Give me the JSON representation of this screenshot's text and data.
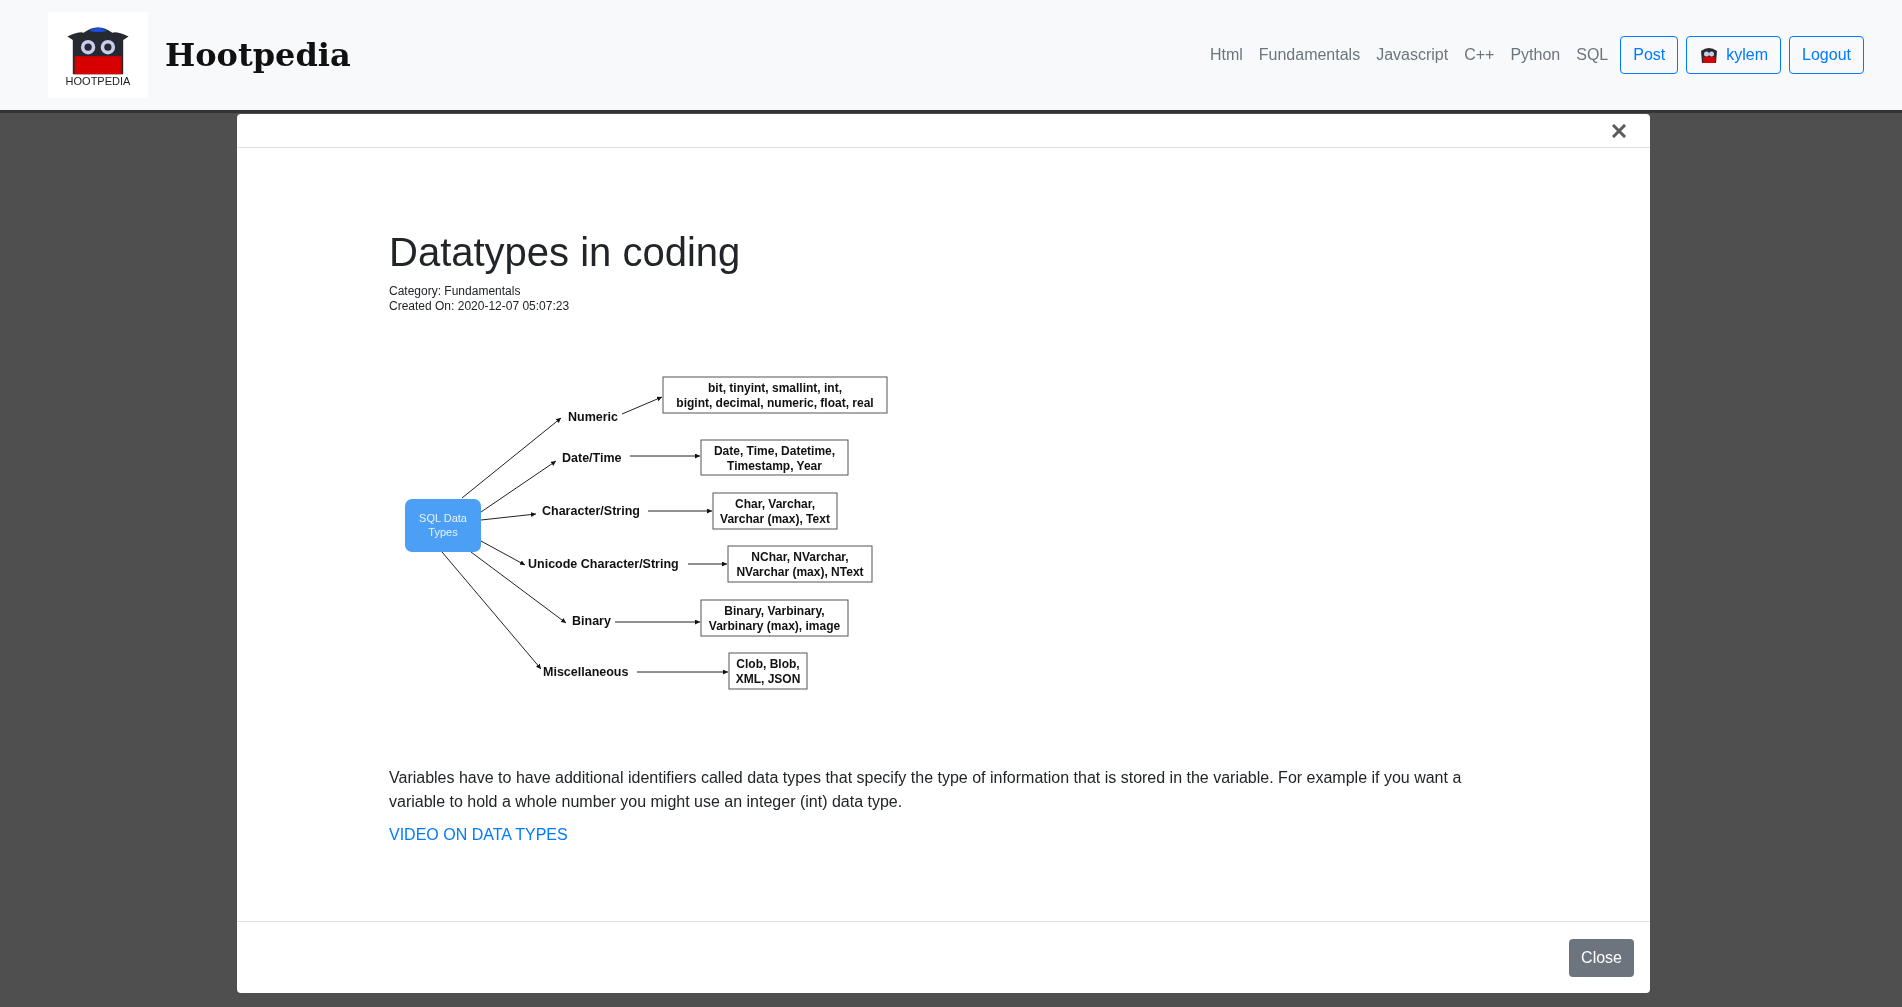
{
  "navbar": {
    "logo_text": "HOOTPEDIA",
    "title": "Hootpedia",
    "links": [
      "Html",
      "Fundamentals",
      "Javascript",
      "C++",
      "Python",
      "SQL"
    ],
    "buttons": [
      {
        "kind": "post",
        "label": "Post"
      },
      {
        "kind": "user",
        "label": "kylem"
      },
      {
        "kind": "logout",
        "label": "Logout"
      }
    ]
  },
  "modal": {
    "title": "Datatypes in coding",
    "category": "Category: Fundamentals",
    "created": "Created On: 2020-12-07 05:07:23",
    "diagram": {
      "root": [
        "SQL Data",
        "Types"
      ],
      "branches": [
        {
          "label": "Numeric",
          "types": [
            "bit, tinyint, smallint, int,",
            "bigint, decimal, numeric, float, real"
          ]
        },
        {
          "label": "Date/Time",
          "types": [
            "Date, Time, Datetime,",
            "Timestamp, Year"
          ]
        },
        {
          "label": "Character/String",
          "types": [
            "Char, Varchar,",
            "Varchar (max), Text"
          ]
        },
        {
          "label": "Unicode Character/String",
          "types": [
            "NChar, NVarchar,",
            "NVarchar (max), NText"
          ]
        },
        {
          "label": "Binary",
          "types": [
            "Binary, Varbinary,",
            "Varbinary (max), image"
          ]
        },
        {
          "label": "Miscellaneous",
          "types": [
            "Clob, Blob,",
            "XML, JSON"
          ]
        }
      ]
    },
    "body": "Variables have to have additional identifiers called data types that specify the type of information that is stored in the variable. For example if you want a variable to hold a whole number you might use an integer (int) data type.",
    "link": "VIDEO ON DATA TYPES",
    "close_button": "Close"
  }
}
